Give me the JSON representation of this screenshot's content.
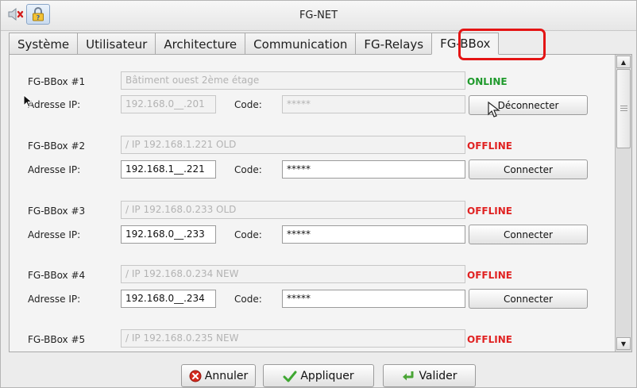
{
  "window": {
    "title": "FG-NET"
  },
  "tabs": [
    {
      "label": "Système"
    },
    {
      "label": "Utilisateur"
    },
    {
      "label": "Architecture"
    },
    {
      "label": "Communication"
    },
    {
      "label": "FG-Relays"
    },
    {
      "label": "FG-BBox",
      "active": true
    }
  ],
  "labels": {
    "ip": "Adresse IP:",
    "code": "Code:"
  },
  "bboxes": [
    {
      "name": "FG-BBox #1",
      "description": "Bâtiment ouest 2ème étage",
      "status": "ONLINE",
      "ip": "192.168.0__.201",
      "code": "*****",
      "action": "Déconnecter",
      "editable": false
    },
    {
      "name": "FG-BBox #2",
      "description": "/ IP 192.168.1.221 OLD",
      "status": "OFFLINE",
      "ip": "192.168.1__.221",
      "code": "*****",
      "action": "Connecter",
      "editable": true
    },
    {
      "name": "FG-BBox #3",
      "description": "/ IP 192.168.0.233 OLD",
      "status": "OFFLINE",
      "ip": "192.168.0__.233",
      "code": "*****",
      "action": "Connecter",
      "editable": true
    },
    {
      "name": "FG-BBox #4",
      "description": "/ IP 192.168.0.234 NEW",
      "status": "OFFLINE",
      "ip": "192.168.0__.234",
      "code": "*****",
      "action": "Connecter",
      "editable": true
    },
    {
      "name": "FG-BBox #5",
      "description": "/ IP 192.168.0.235 NEW",
      "status": "OFFLINE"
    }
  ],
  "footer": {
    "cancel": "Annuler",
    "apply": "Appliquer",
    "validate": "Valider"
  },
  "colors": {
    "online": "#1f9a2c",
    "offline": "#e02222",
    "highlight": "#e41414"
  },
  "icons": [
    "mute-speaker-icon",
    "lock-icon",
    "cancel-icon",
    "checkmark-icon",
    "enter-arrow-icon"
  ]
}
